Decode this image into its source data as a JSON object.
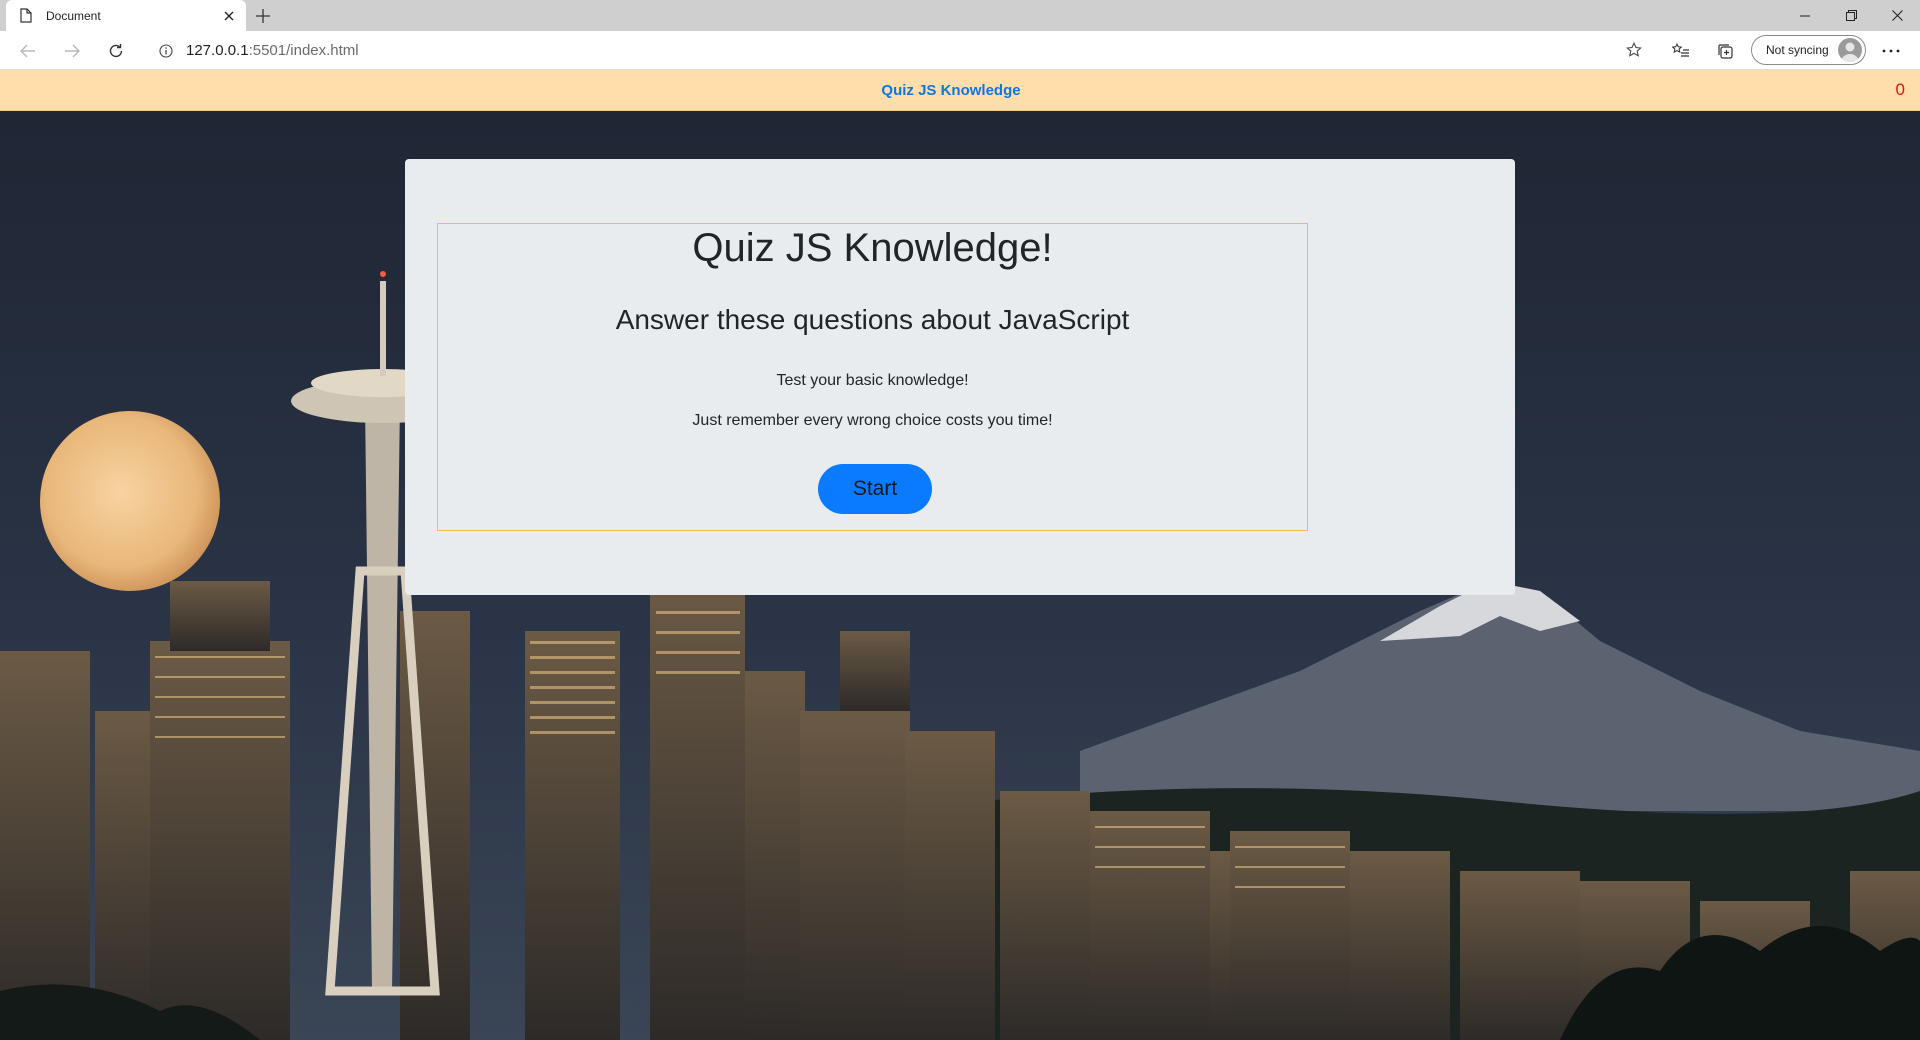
{
  "browser": {
    "tab_title": "Document",
    "url_host": "127.0.0.1",
    "url_rest": ":5501/index.html",
    "sync_label": "Not syncing"
  },
  "header": {
    "title": "Quiz JS Knowledge",
    "timer": "0"
  },
  "quiz": {
    "title": "Quiz JS Knowledge!",
    "subtitle": "Answer these questions about JavaScript",
    "intro_line_1": "Test your basic knowledge!",
    "intro_line_2": "Just remember every wrong choice costs you time!",
    "start_label": "Start"
  },
  "colors": {
    "header_bg": "#ffdeaa",
    "header_title": "#0e76e0",
    "timer": "#d11a1a",
    "card_bg": "#e9ecef",
    "intro_border": "#f0c040",
    "start_button": "#0a7bff"
  },
  "background": {
    "description_icon": "city-skyline-image"
  }
}
